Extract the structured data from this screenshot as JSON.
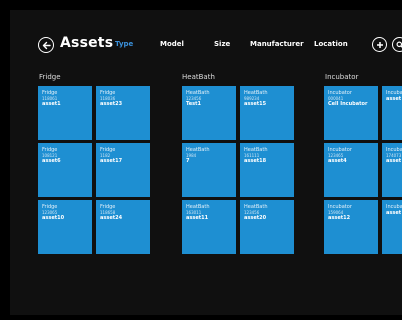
{
  "app": {
    "title": "Assets"
  },
  "tabs": [
    {
      "label": "Type",
      "active": true
    },
    {
      "label": "Model",
      "active": false
    },
    {
      "label": "Size",
      "active": false
    },
    {
      "label": "Manufacturer",
      "active": false
    },
    {
      "label": "Location",
      "active": false
    }
  ],
  "icons": {
    "back": "back-arrow-icon",
    "add": "plus-icon",
    "search": "search-icon"
  },
  "colors": {
    "background": "#101010",
    "tile": "#1e8fd2",
    "active_tab": "#3a8fd8"
  },
  "groups": [
    {
      "title": "Fridge",
      "tiles": [
        {
          "name": "Fridge",
          "id": "118061",
          "asset": "asset1"
        },
        {
          "name": "Fridge",
          "id": "118036",
          "asset": "asset23"
        },
        {
          "name": "Fridge",
          "id": "108121",
          "asset": "asset6"
        },
        {
          "name": "Fridge",
          "id": "1182",
          "asset": "asset17"
        },
        {
          "name": "Fridge",
          "id": "123065",
          "asset": "asset10"
        },
        {
          "name": "Fridge",
          "id": "118658",
          "asset": "asset24"
        }
      ]
    },
    {
      "title": "HeatBath",
      "tiles": [
        {
          "name": "HeatBath",
          "id": "123456",
          "asset": "Test1"
        },
        {
          "name": "HeatBath",
          "id": "989234",
          "asset": "asset15"
        },
        {
          "name": "HeatBath",
          "id": "1984",
          "asset": "7"
        },
        {
          "name": "HeatBath",
          "id": "161111",
          "asset": "asset18"
        },
        {
          "name": "HeatBath",
          "id": "163011",
          "asset": "asset11"
        },
        {
          "name": "HeatBath",
          "id": "123456",
          "asset": "asset20"
        }
      ]
    },
    {
      "title": "Incubator",
      "tiles": [
        {
          "name": "Incubator",
          "id": "000041",
          "asset": "Cell Incubator"
        },
        {
          "name": "Incubat",
          "id": "",
          "asset": "asset"
        },
        {
          "name": "Incubator",
          "id": "123465",
          "asset": "asset4"
        },
        {
          "name": "Incubat",
          "id": "174073",
          "asset": "asset"
        },
        {
          "name": "Incubator",
          "id": "159064",
          "asset": "asset12"
        },
        {
          "name": "Incubat",
          "id": "",
          "asset": "asset"
        }
      ]
    }
  ]
}
